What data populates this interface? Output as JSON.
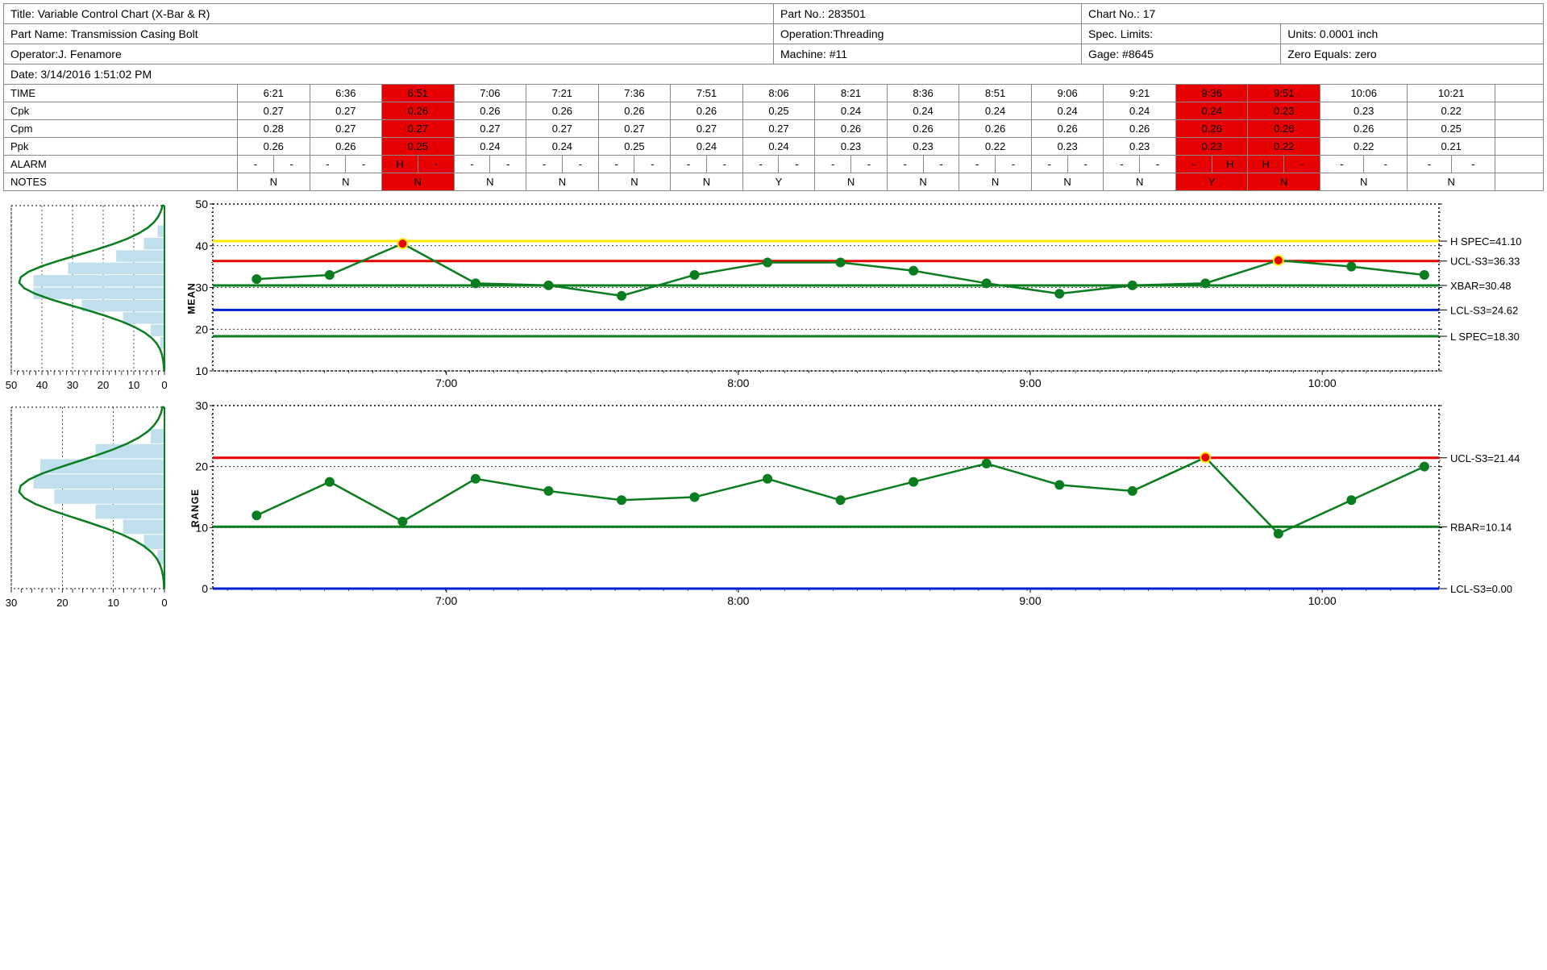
{
  "header": {
    "row1": {
      "title_label": "Title:",
      "title": "Variable Control Chart (X-Bar & R)",
      "partno_label": "Part No.:",
      "partno": "283501",
      "chartno_label": "Chart No.:",
      "chartno": "17"
    },
    "row2": {
      "partname_label": "Part Name:",
      "partname": "Transmission Casing Bolt",
      "operation_label": "Operation:",
      "operation": "Threading",
      "speclimits_label": "Spec. Limits:",
      "speclimits": "",
      "units_label": "Units:",
      "units": "0.0001 inch"
    },
    "row3": {
      "operator_label": "Operator:",
      "operator": "J. Fenamore",
      "machine_label": "Machine:",
      "machine": "#11",
      "gage_label": "Gage:",
      "gage": "#8645",
      "zero_label": "Zero Equals:",
      "zero": "zero"
    },
    "date_label": "Date:",
    "date": "3/14/2016 1:51:02 PM"
  },
  "table": {
    "rows": {
      "time_label": "TIME",
      "cpk_label": "Cpk",
      "cpm_label": "Cpm",
      "ppk_label": "Ppk",
      "alarm_label": "ALARM",
      "notes_label": "NOTES"
    },
    "red_cols": [
      2,
      13,
      14
    ],
    "time": [
      "6:21",
      "6:36",
      "6:51",
      "7:06",
      "7:21",
      "7:36",
      "7:51",
      "8:06",
      "8:21",
      "8:36",
      "8:51",
      "9:06",
      "9:21",
      "9:36",
      "9:51",
      "10:06",
      "10:21"
    ],
    "cpk": [
      "0.27",
      "0.27",
      "0.26",
      "0.26",
      "0.26",
      "0.26",
      "0.26",
      "0.25",
      "0.24",
      "0.24",
      "0.24",
      "0.24",
      "0.24",
      "0.24",
      "0.23",
      "0.23",
      "0.22"
    ],
    "cpm": [
      "0.28",
      "0.27",
      "0.27",
      "0.27",
      "0.27",
      "0.27",
      "0.27",
      "0.27",
      "0.26",
      "0.26",
      "0.26",
      "0.26",
      "0.26",
      "0.26",
      "0.26",
      "0.26",
      "0.25"
    ],
    "ppk": [
      "0.26",
      "0.26",
      "0.25",
      "0.24",
      "0.24",
      "0.25",
      "0.24",
      "0.24",
      "0.23",
      "0.23",
      "0.22",
      "0.23",
      "0.23",
      "0.23",
      "0.22",
      "0.22",
      "0.21"
    ],
    "alarm": [
      [
        "-",
        "-"
      ],
      [
        "-",
        "-"
      ],
      [
        "H",
        "-"
      ],
      [
        "-",
        "-"
      ],
      [
        "-",
        "-"
      ],
      [
        "-",
        "-"
      ],
      [
        "-",
        "-"
      ],
      [
        "-",
        "-"
      ],
      [
        "-",
        "-"
      ],
      [
        "-",
        "-"
      ],
      [
        "-",
        "-"
      ],
      [
        "-",
        "-"
      ],
      [
        "-",
        "-"
      ],
      [
        "-",
        "H"
      ],
      [
        "H",
        "-"
      ],
      [
        "-",
        "-"
      ],
      [
        "-",
        "-"
      ]
    ],
    "notes": [
      "N",
      "N",
      "N",
      "N",
      "N",
      "N",
      "N",
      "Y",
      "N",
      "N",
      "N",
      "N",
      "N",
      "Y",
      "N",
      "N",
      "N"
    ]
  },
  "chart_data": [
    {
      "type": "line",
      "name": "mean_chart",
      "ylabel": "MEAN",
      "ylim": [
        10,
        50
      ],
      "yticks": [
        10,
        20,
        30,
        40,
        50
      ],
      "xticks": [
        "7:00",
        "8:00",
        "9:00",
        "10:00"
      ],
      "x": [
        6.35,
        6.6,
        6.85,
        7.1,
        7.35,
        7.6,
        7.85,
        8.1,
        8.35,
        8.6,
        8.85,
        9.1,
        9.35,
        9.6,
        9.85,
        10.1,
        10.35
      ],
      "values": [
        32,
        33,
        40.5,
        31,
        30.5,
        28,
        33,
        36,
        36,
        34,
        31,
        28.5,
        30.5,
        31,
        36.5,
        35,
        33
      ],
      "red_points": [
        2,
        14
      ],
      "lines": [
        {
          "label": "H SPEC=41.10",
          "value": 41.1,
          "color": "#ffea00",
          "weight": 3
        },
        {
          "label": "UCL-S3=36.33",
          "value": 36.33,
          "color": "#e60000",
          "weight": 3
        },
        {
          "label": "XBAR=30.48",
          "value": 30.48,
          "color": "#0a7d1f",
          "weight": 3
        },
        {
          "label": "LCL-S3=24.62",
          "value": 24.62,
          "color": "#0020d0",
          "weight": 3
        },
        {
          "label": "L SPEC=18.30",
          "value": 18.3,
          "color": "#0a7d1f",
          "weight": 3
        }
      ]
    },
    {
      "type": "line",
      "name": "range_chart",
      "ylabel": "RANGE",
      "ylim": [
        0,
        30
      ],
      "yticks": [
        0,
        10,
        20,
        30
      ],
      "xticks": [
        "7:00",
        "8:00",
        "9:00",
        "10:00"
      ],
      "x": [
        6.35,
        6.6,
        6.85,
        7.1,
        7.35,
        7.6,
        7.85,
        8.1,
        8.35,
        8.6,
        8.85,
        9.1,
        9.35,
        9.6,
        9.85,
        10.1,
        10.35
      ],
      "values": [
        12,
        17.5,
        11,
        18,
        16,
        14.5,
        15,
        18,
        14.5,
        17.5,
        20.5,
        17,
        16,
        21.5,
        9,
        14.5,
        20
      ],
      "red_points": [
        13
      ],
      "lines": [
        {
          "label": "UCL-S3=21.44",
          "value": 21.44,
          "color": "#e60000",
          "weight": 3
        },
        {
          "label": "RBAR=10.14",
          "value": 10.14,
          "color": "#0a7d1f",
          "weight": 3
        },
        {
          "label": "LCL-S3=0.00",
          "value": 0.0,
          "color": "#0020d0",
          "weight": 3
        }
      ]
    }
  ],
  "histograms": [
    {
      "name": "mean_hist",
      "xlim": [
        0,
        50
      ],
      "xticks": [
        50,
        40,
        30,
        20,
        10,
        0
      ],
      "bars": [
        0.05,
        0.15,
        0.35,
        0.7,
        0.95,
        0.95,
        0.6,
        0.3,
        0.1,
        0.03
      ],
      "bar_start": 42,
      "bar_end": 22,
      "curve_peak": 33
    },
    {
      "name": "range_hist",
      "xlim": [
        0,
        30
      ],
      "xticks": [
        30,
        20,
        10,
        0
      ],
      "bars": [
        0.1,
        0.5,
        0.9,
        0.95,
        0.8,
        0.5,
        0.3,
        0.15,
        0.05
      ],
      "bar_start": 24,
      "bar_end": 6,
      "curve_peak": 15
    }
  ]
}
